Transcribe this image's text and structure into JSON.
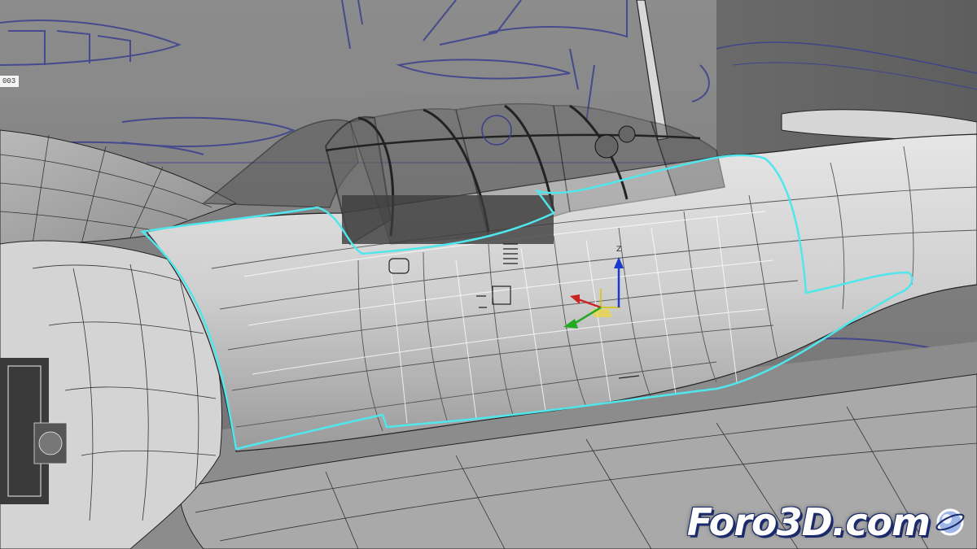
{
  "viewport": {
    "object_label": "003",
    "gizmo_axis_z": "Z",
    "selection_color": "#4fe6ec",
    "blueprint_color": "#3a3f8f",
    "background_color": "#7a7a7a"
  },
  "watermark": {
    "text": "Foro3D.com"
  }
}
